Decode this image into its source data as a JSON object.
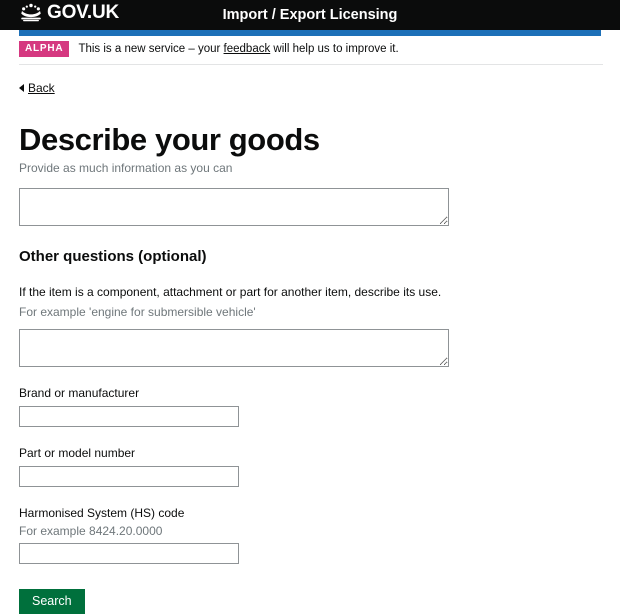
{
  "header": {
    "brand_text": "GOV.UK",
    "crown_icon": "royal-crown-icon",
    "service_name": "Import / Export Licensing"
  },
  "phase_banner": {
    "tag": "ALPHA",
    "text_before": "This is a new service – your ",
    "link_text": "feedback",
    "text_after": " will help us to improve it."
  },
  "back_link": {
    "label": "Back",
    "icon": "chevron-left-icon"
  },
  "main": {
    "heading": "Describe your goods",
    "heading_hint": "Provide as much information as you can",
    "goods_description": {
      "value": "",
      "placeholder": ""
    },
    "section_heading": "Other questions (optional)",
    "component_use": {
      "label": "If the item is a component, attachment or part for another item, describe its use.",
      "hint": "For example 'engine for submersible vehicle'",
      "value": "",
      "placeholder": ""
    },
    "brand": {
      "label": "Brand or manufacturer",
      "value": "",
      "placeholder": ""
    },
    "part_number": {
      "label": "Part or model number",
      "value": "",
      "placeholder": ""
    },
    "hs_code": {
      "label": "Harmonised System (HS) code",
      "hint": "For example 8424.20.0000",
      "value": "",
      "placeholder": ""
    },
    "submit_label": "Search"
  },
  "colors": {
    "header_black": "#0b0c0c",
    "accent_blue": "#1d70b8",
    "alpha_pink": "#d53880",
    "button_green": "#00703c",
    "hint_grey": "#6f777b",
    "border_grey": "#8f9396"
  }
}
